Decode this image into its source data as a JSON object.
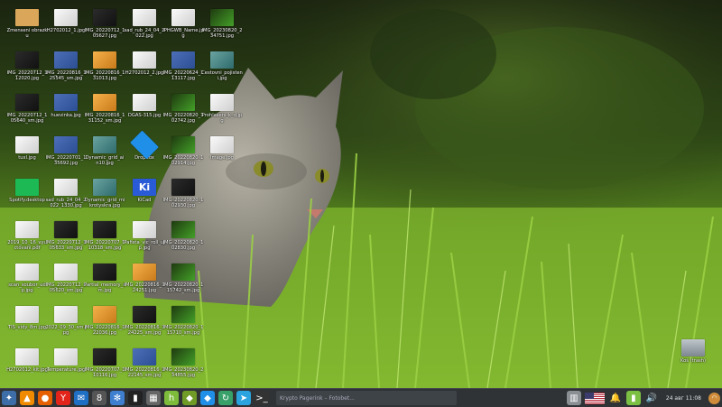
{
  "desktop": {
    "icons": [
      {
        "name": "folder",
        "label": "Zmenseni obrazku",
        "thumb": "t-folder",
        "icon": "folder-icon"
      },
      {
        "name": "H2702012_1",
        "label": "H2702012_1.jpg",
        "thumb": "t-img",
        "icon": "image-icon"
      },
      {
        "name": "IMG_20220712_105627",
        "label": "IMG_20220712_105627.jpg",
        "thumb": "t-dark",
        "icon": "image-icon"
      },
      {
        "name": "sad_rub_24_04",
        "label": "sad_rub_24_04_2022.jpg",
        "thumb": "t-img",
        "icon": "image-icon"
      },
      {
        "name": "IPHGWB_Name",
        "label": "IPHGWB_Name.jpg",
        "thumb": "t-img",
        "icon": "image-icon"
      },
      {
        "name": "IMG_20230820_234751",
        "label": "IMG_20230820_234751.jpg",
        "thumb": "t-green",
        "icon": "image-icon"
      },
      {
        "name": "IMG_a",
        "label": "IMG_20220712_112020.jpg",
        "thumb": "t-dark",
        "icon": "image-icon"
      },
      {
        "name": "IMG_b",
        "label": "IMG_20220816_125545_sm.jpg",
        "thumb": "t-blue",
        "icon": "image-icon"
      },
      {
        "name": "IMG_c",
        "label": "IMG_20220816_131013.jpg",
        "thumb": "t-orange",
        "icon": "image-icon"
      },
      {
        "name": "H2702012_2",
        "label": "H2702012_2.jpg",
        "thumb": "t-img",
        "icon": "image-icon"
      },
      {
        "name": "IMG_d",
        "label": "IMG_20220624_113117.jpg",
        "thumb": "t-blue",
        "icon": "image-icon"
      },
      {
        "name": "Cestovni",
        "label": "Cestovni_pojisteni.jpg",
        "thumb": "t-teal",
        "icon": "image-icon"
      },
      {
        "name": "IMG_e",
        "label": "IMG_20220712_105640_sm.jpg",
        "thumb": "t-dark",
        "icon": "image-icon"
      },
      {
        "name": "huevinka",
        "label": "huevinka.jpg",
        "thumb": "t-blue",
        "icon": "image-icon"
      },
      {
        "name": "IMG_f",
        "label": "IMG_20220816_131152_sm.jpg",
        "thumb": "t-orange",
        "icon": "image-icon"
      },
      {
        "name": "DGAS-315",
        "label": "DGAS-315.jpg",
        "thumb": "t-img",
        "icon": "image-icon"
      },
      {
        "name": "IMG_g",
        "label": "IMG_20220820_102742.jpg",
        "thumb": "t-green",
        "icon": "image-icon"
      },
      {
        "name": "Prohlaseni",
        "label": "Prohlaseni_k_d.jpg",
        "thumb": "t-img",
        "icon": "image-icon"
      },
      {
        "name": "tuxl",
        "label": "tuxl.jpg",
        "thumb": "t-img",
        "icon": "image-icon"
      },
      {
        "name": "IMG_h",
        "label": "IMG_20220701_135692.jpg",
        "thumb": "t-blue",
        "icon": "image-icon"
      },
      {
        "name": "Dynamic_grid_a",
        "label": "Dynamic_grid_ain10.jpg",
        "thumb": "t-teal",
        "icon": "image-icon"
      },
      {
        "name": "Dropbox",
        "label": "Dropbox",
        "thumb": "t-dbx",
        "icon": "dropbox-icon"
      },
      {
        "name": "IMG_i",
        "label": "IMG_20220820_102914.jpg",
        "thumb": "t-green",
        "icon": "image-icon"
      },
      {
        "name": "Image",
        "label": "Image.jpg",
        "thumb": "t-img",
        "icon": "image-icon"
      },
      {
        "name": "Spotify",
        "label": "Spotify.desktop",
        "thumb": "t-spot",
        "icon": "spotify-icon"
      },
      {
        "name": "sad_rub_b",
        "label": "sad_rub_24_04_2022_1330.jpg",
        "thumb": "t-img",
        "icon": "image-icon"
      },
      {
        "name": "Dynamic_grid_b",
        "label": "Dynamic_grid_mikrotyskra.jpg",
        "thumb": "t-teal",
        "icon": "image-icon"
      },
      {
        "name": "KiCad",
        "label": "KiCad",
        "thumb": "t-kicad",
        "icon": "kicad-icon"
      },
      {
        "name": "IMG_j",
        "label": "IMG_20220820_102930.jpg",
        "thumb": "t-dark",
        "icon": "image-icon"
      },
      {
        "name": "doc_a",
        "label": "2019_10_16_vyuctovani.pdf",
        "thumb": "t-img",
        "icon": "document-icon"
      },
      {
        "name": "IMG_k",
        "label": "IMG_20220712_105633_sm.jpg",
        "thumb": "t-dark",
        "icon": "image-icon"
      },
      {
        "name": "IMG_l",
        "label": "IMG_20220707_110318_sm.jpg",
        "thumb": "t-dark",
        "icon": "image-icon"
      },
      {
        "name": "Pafista",
        "label": "Pafista_vic_roll_ujp.jpg",
        "thumb": "t-img",
        "icon": "image-icon"
      },
      {
        "name": "IMG_m",
        "label": "IMG_20220820_102830.jpg",
        "thumb": "t-green",
        "icon": "image-icon"
      },
      {
        "name": "doc_b",
        "label": "scan_soubor_udp.jpg",
        "thumb": "t-img",
        "icon": "image-icon"
      },
      {
        "name": "IMG_n",
        "label": "IMG_20220712_105620_sm.jpg",
        "thumb": "t-img",
        "icon": "image-icon"
      },
      {
        "name": "Partial_memory",
        "label": "Partial_memory_sm.jpg",
        "thumb": "t-dark",
        "icon": "image-icon"
      },
      {
        "name": "IMG_o",
        "label": "IMG_20220816_124251.jpg",
        "thumb": "t-orange",
        "icon": "image-icon"
      },
      {
        "name": "IMG_p",
        "label": "IMG_20220820_115742_sm.jpg",
        "thumb": "t-green",
        "icon": "image-icon"
      },
      {
        "name": "doc_c",
        "label": "TIS_vidy_8m.jpg",
        "thumb": "t-img",
        "icon": "image-icon"
      },
      {
        "name": "doc_d",
        "label": "2022_09_30_sm.jpg",
        "thumb": "t-img",
        "icon": "image-icon"
      },
      {
        "name": "IMG_q",
        "label": "IMG_20220816_122036.jpg",
        "thumb": "t-orange",
        "icon": "image-icon"
      },
      {
        "name": "IMG_r",
        "label": "IMG_20220816_124225_sm.jpg",
        "thumb": "t-dark",
        "icon": "image-icon"
      },
      {
        "name": "IMG_s",
        "label": "IMG_20220820_115710_sm.jpg",
        "thumb": "t-green",
        "icon": "image-icon"
      },
      {
        "name": "H2702012_kit",
        "label": "H2702012_kit.jpg",
        "thumb": "t-img",
        "icon": "image-icon"
      },
      {
        "name": "Temperature",
        "label": "Temperature.jpg",
        "thumb": "t-img",
        "icon": "image-icon"
      },
      {
        "name": "IMG_t",
        "label": "IMG_20220707_110116.jpg",
        "thumb": "t-dark",
        "icon": "image-icon"
      },
      {
        "name": "IMG_u",
        "label": "IMG_20220816_122145_sm.jpg",
        "thumb": "t-blue",
        "icon": "image-icon"
      },
      {
        "name": "IMG_v",
        "label": "IMG_20230820_234855.jpg",
        "thumb": "t-green",
        "icon": "image-icon"
      },
      {
        "name": "Kos",
        "label": "Koš (trash)",
        "thumb": "t-trash",
        "icon": "trash-icon"
      }
    ]
  },
  "taskbar": {
    "launchers": [
      {
        "name": "start-menu",
        "icon": "start-menu-icon",
        "glyph": "✦",
        "color": "#3d6ea8"
      },
      {
        "name": "vlc",
        "icon": "vlc-icon",
        "glyph": "▲",
        "color": "#f08a00"
      },
      {
        "name": "firefox",
        "icon": "firefox-icon",
        "glyph": "●",
        "color": "#e66000"
      },
      {
        "name": "yandex",
        "icon": "yandex-icon",
        "glyph": "Y",
        "color": "#e3241b"
      },
      {
        "name": "thunderbird",
        "icon": "thunderbird-icon",
        "glyph": "✉",
        "color": "#1f6fc5"
      },
      {
        "name": "app-8",
        "icon": "app-icon",
        "glyph": "8",
        "color": "#555"
      },
      {
        "name": "compass",
        "icon": "compass-icon",
        "glyph": "✻",
        "color": "#3f7fd0"
      },
      {
        "name": "terminal",
        "icon": "terminal-icon",
        "glyph": "▮",
        "color": "#222"
      },
      {
        "name": "calculator",
        "icon": "calculator-icon",
        "glyph": "▦",
        "color": "#666"
      },
      {
        "name": "h-app",
        "icon": "h-app-icon",
        "glyph": "h",
        "color": "#7cbc3a"
      },
      {
        "name": "green-app",
        "icon": "green-app-icon",
        "glyph": "◆",
        "color": "#6f9b26"
      },
      {
        "name": "dropbox",
        "icon": "dropbox-icon",
        "glyph": "◆",
        "color": "#1f8fe8"
      },
      {
        "name": "refresh",
        "icon": "refresh-icon",
        "glyph": "↻",
        "color": "#38a169"
      },
      {
        "name": "telegram",
        "icon": "telegram-icon",
        "glyph": "➤",
        "color": "#2aa3df"
      },
      {
        "name": "terminal-2",
        "icon": "terminal-icon",
        "glyph": ">_",
        "color": "#333"
      }
    ],
    "active_window": "Krypto Pagerink – Fotobet...",
    "clock": "24 авг 11:08",
    "tray": [
      {
        "name": "panel",
        "icon": "panel-icon",
        "glyph": "▥",
        "color": "#8a8f94"
      },
      {
        "name": "keyboard-layout",
        "icon": "flag-us-icon",
        "glyph": "",
        "color": "#b22234"
      },
      {
        "name": "notifications",
        "icon": "bell-icon",
        "glyph": "🔔",
        "color": "transparent"
      },
      {
        "name": "battery",
        "icon": "battery-icon",
        "glyph": "▮",
        "color": "#7bc043"
      },
      {
        "name": "volume",
        "icon": "volume-icon",
        "glyph": "🔊",
        "color": "transparent"
      }
    ]
  }
}
